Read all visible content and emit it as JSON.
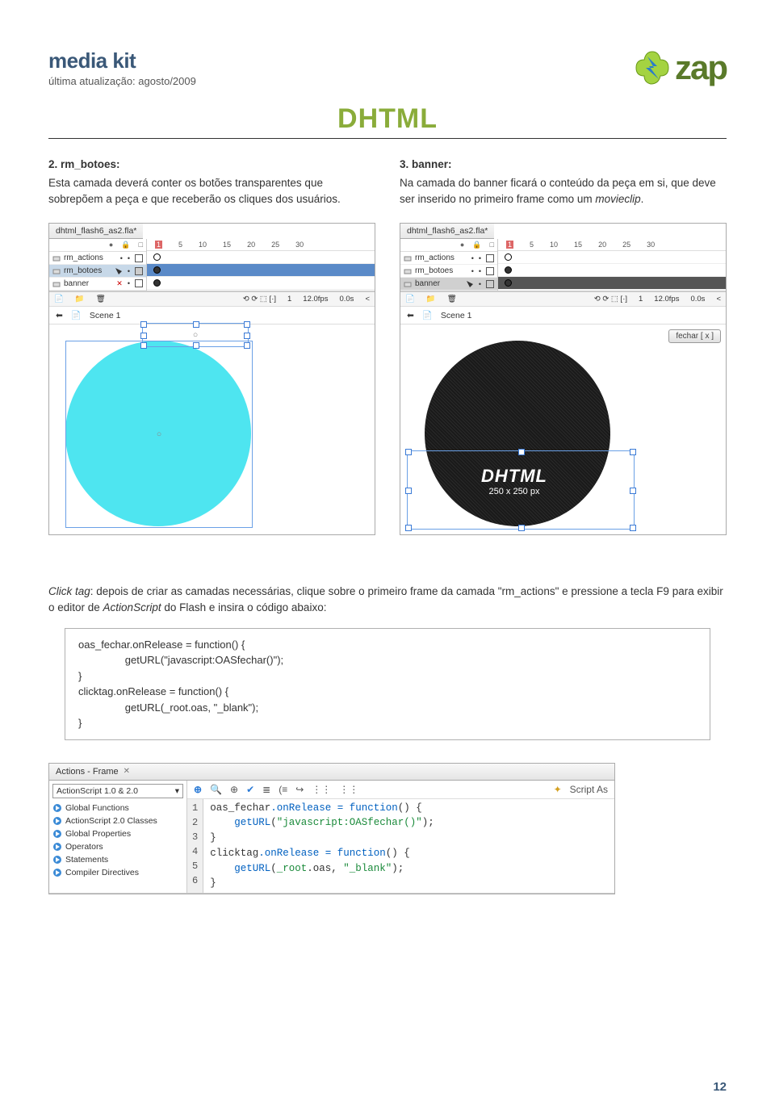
{
  "header": {
    "title": "media kit",
    "subtitle": "última atualização: agosto/2009",
    "logo_text": "zap"
  },
  "main_title": "DHTML",
  "col_left": {
    "heading": "2. rm_botoes:",
    "body": "Esta camada deverá conter os botões transparentes que sobrepõem a peça e que receberão os cliques dos usuários."
  },
  "col_right": {
    "heading": "3. banner:",
    "body_pre": "Na camada do banner ficará o conteúdo da peça em si, que deve ser inserido no primeiro frame como um ",
    "body_ital": "movieclip",
    "body_post": "."
  },
  "flash": {
    "filename": "dhtml_flash6_as2.fla*",
    "layers": [
      "rm_actions",
      "rm_botoes",
      "banner"
    ],
    "ruler": [
      "1",
      "5",
      "10",
      "15",
      "20",
      "25",
      "30"
    ],
    "status_frame": "1",
    "fps": "12.0fps",
    "time": "0.0s",
    "scene": "Scene 1",
    "fechar_label": "fechar [ x ]",
    "stage2_big": "DHTML",
    "stage2_small": "250 x 250 px"
  },
  "clicktag": {
    "text_pre": "Click tag",
    "text_body": ": depois de criar as camadas necessárias, clique sobre o primeiro frame da camada \"rm_actions\" e pressione a tecla F9 para exibir o editor de ",
    "text_ital": "ActionScript",
    "text_after": " do Flash e insira o código abaixo:"
  },
  "code_block": "oas_fechar.onRelease = function() {\n                getURL(\"javascript:OASfechar()\");\n}\nclicktag.onRelease = function() {\n                getURL(_root.oas, \"_blank\");\n}",
  "as_panel": {
    "tab": "Actions - Frame",
    "dropdown": "ActionScript 1.0 & 2.0",
    "tree": [
      "Global Functions",
      "ActionScript 2.0 Classes",
      "Global Properties",
      "Operators",
      "Statements",
      "Compiler Directives"
    ],
    "script_as": "Script As",
    "lines": [
      "1",
      "2",
      "3",
      "4",
      "5",
      "6"
    ],
    "code": {
      "l1a": "oas_fechar",
      "l1b": ".onRelease = ",
      "l1c": "function",
      "l1d": "() {",
      "l2a": "    getURL",
      "l2b": "(",
      "l2c": "\"javascript:OASfechar()\"",
      "l2d": ");",
      "l3": "}",
      "l4a": "clicktag",
      "l4b": ".onRelease = ",
      "l4c": "function",
      "l4d": "() {",
      "l5a": "    getURL",
      "l5b": "(",
      "l5c": "_root",
      "l5d": ".oas, ",
      "l5e": "\"_blank\"",
      "l5f": ");",
      "l6": "}"
    }
  },
  "page_number": "12"
}
